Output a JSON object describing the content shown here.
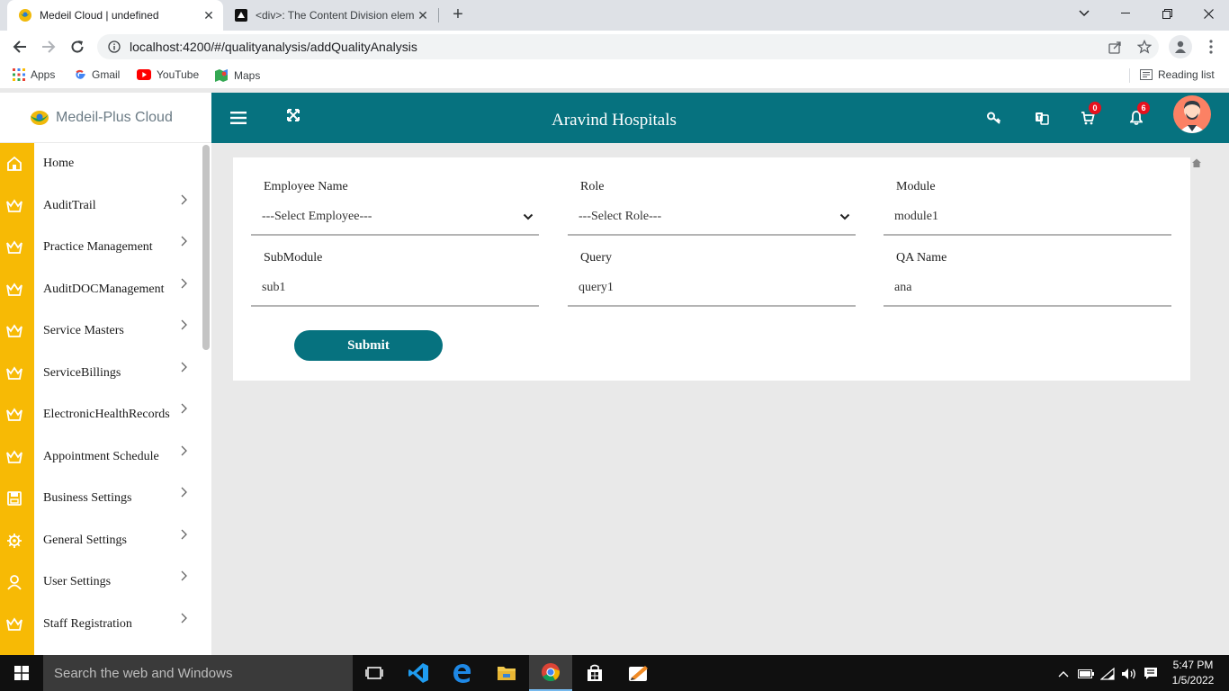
{
  "browser": {
    "tabs": [
      {
        "title": "Medeil Cloud | undefined",
        "active": true
      },
      {
        "title": "<div>: The Content Division elem",
        "active": false
      }
    ],
    "url": "localhost:4200/#/qualityanalysis/addQualityAnalysis",
    "bookmarks": [
      "Apps",
      "Gmail",
      "YouTube",
      "Maps"
    ],
    "reading_list": "Reading list"
  },
  "app": {
    "brand": "Medeil-Plus Cloud",
    "title": "Aravind Hospitals",
    "cart_count": "0",
    "notification_count": "6",
    "colors": {
      "primary": "#06727f",
      "rail": "#f7ba05",
      "badge": "#e8101d"
    }
  },
  "sidebar": {
    "items": [
      {
        "label": "Home",
        "icon": "home-icon"
      },
      {
        "label": "AuditTrail",
        "icon": "crown-icon"
      },
      {
        "label": "Practice Management",
        "icon": "crown-icon"
      },
      {
        "label": "AuditDOCManagement",
        "icon": "crown-icon"
      },
      {
        "label": "Service Masters",
        "icon": "crown-icon"
      },
      {
        "label": "ServiceBillings",
        "icon": "crown-icon"
      },
      {
        "label": "ElectronicHealthRecords",
        "icon": "crown-icon"
      },
      {
        "label": "Appointment Schedule",
        "icon": "crown-icon"
      },
      {
        "label": "Business Settings",
        "icon": "save-icon"
      },
      {
        "label": "General Settings",
        "icon": "gear-icon"
      },
      {
        "label": "User Settings",
        "icon": "user-icon"
      },
      {
        "label": "Staff Registration",
        "icon": "crown-icon"
      }
    ]
  },
  "form": {
    "employee_name": {
      "label": "Employee Name",
      "value": "---Select Employee---"
    },
    "role": {
      "label": "Role",
      "value": "---Select Role---"
    },
    "module": {
      "label": "Module",
      "value": "module1"
    },
    "submodule": {
      "label": "SubModule",
      "value": "sub1"
    },
    "query": {
      "label": "Query",
      "value": "query1"
    },
    "qa_name": {
      "label": "QA Name",
      "value": "ana"
    },
    "submit_label": "Submit"
  },
  "taskbar": {
    "search_placeholder": "Search the web and Windows",
    "time": "5:47 PM",
    "date": "1/5/2022"
  }
}
